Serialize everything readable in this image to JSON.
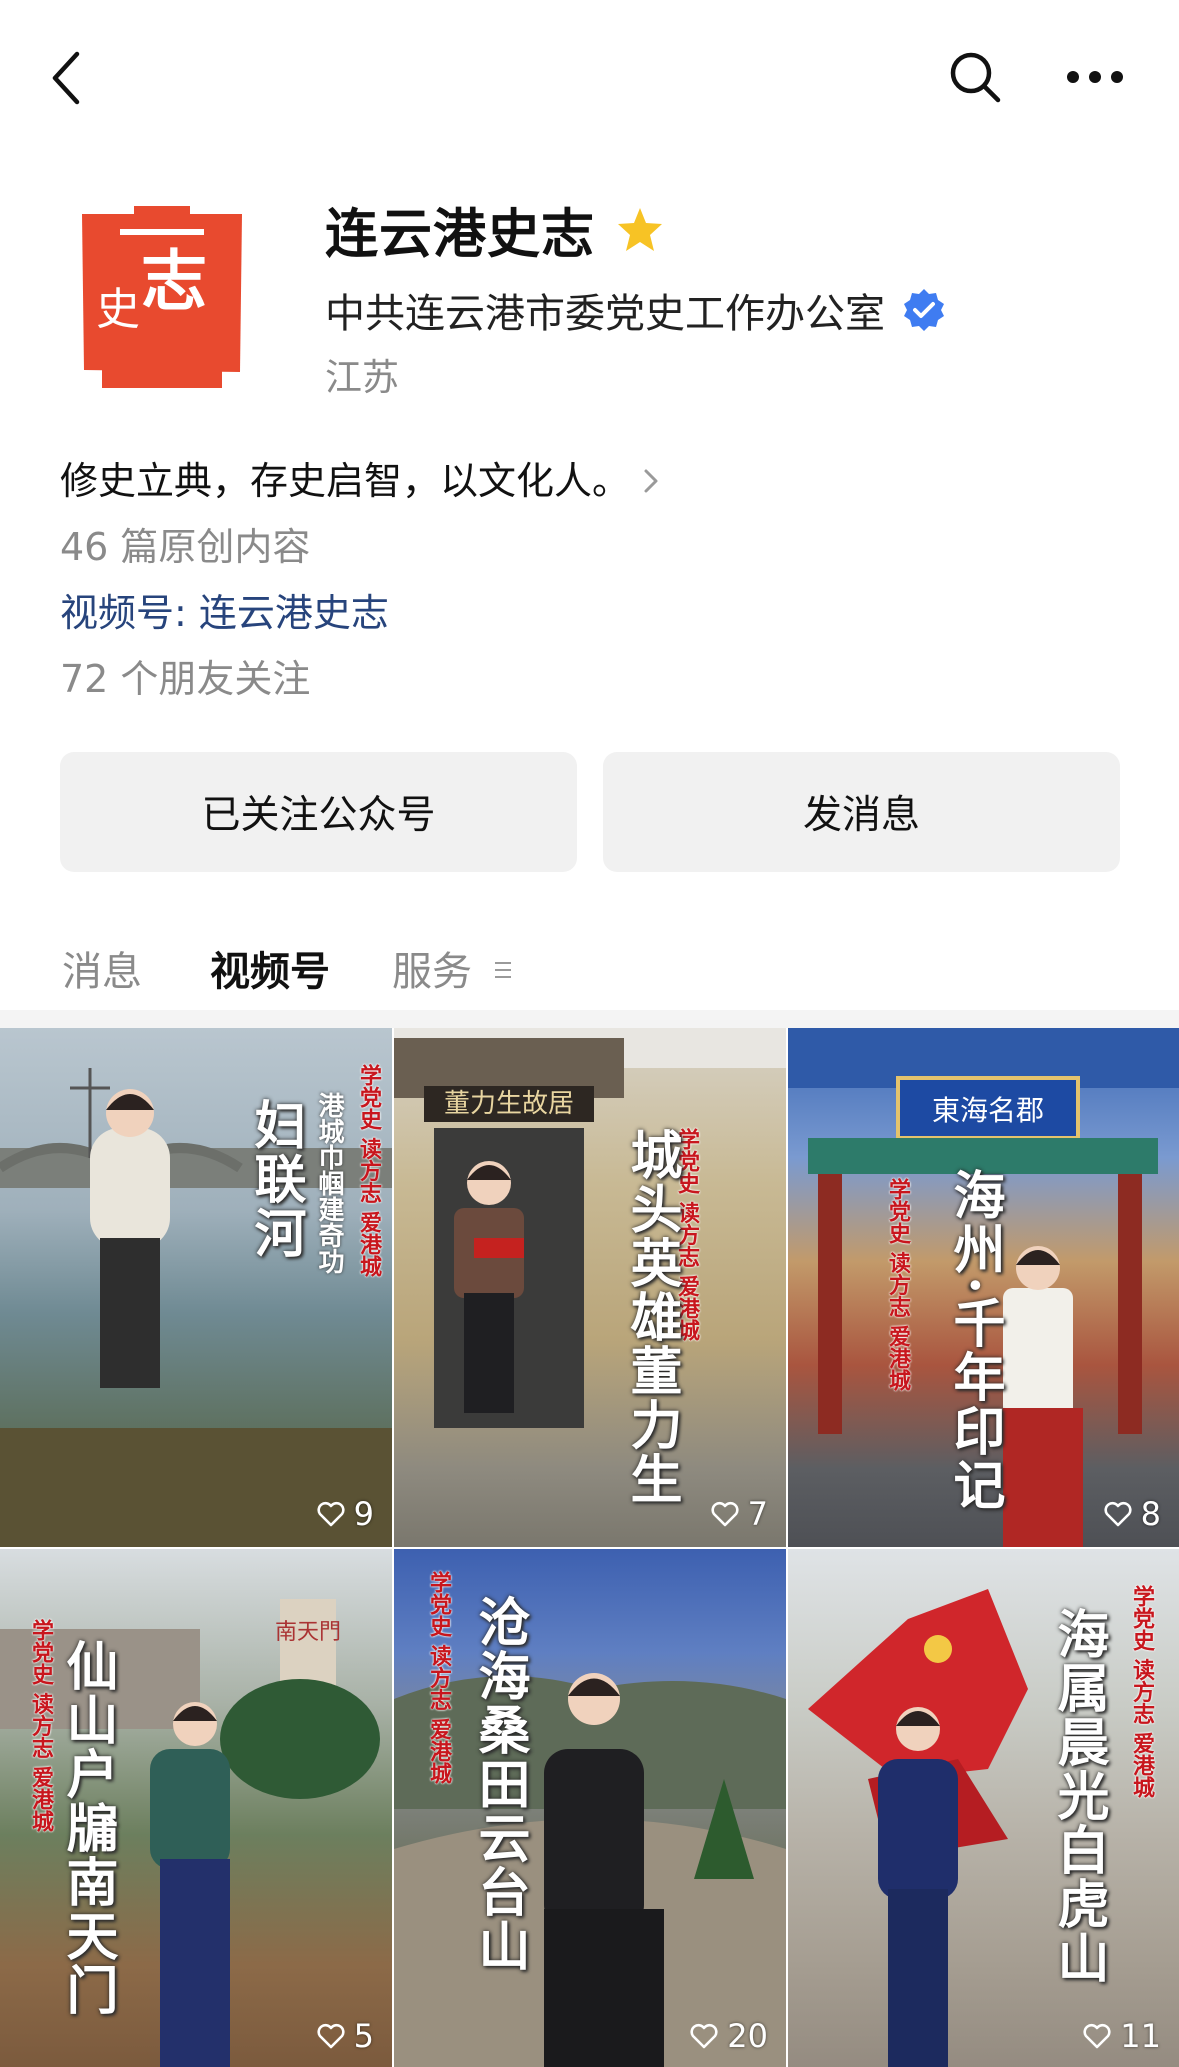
{
  "header": {
    "back_icon": "chevron-left-icon",
    "search_icon": "search-icon",
    "more_icon": "more-horizontal-icon"
  },
  "profile": {
    "name": "连云港史志",
    "organization": "中共连云港市委党史工作办公室",
    "region": "江苏",
    "logo_color": "#e84a2f",
    "star_color": "#f7c325",
    "verified_color": "#3f7cf1"
  },
  "info": {
    "slogan": "修史立典，存史启智，以文化人。",
    "articles": "46 篇原创内容",
    "channel": "视频号: 连云港史志",
    "friends": "72 个朋友关注"
  },
  "buttons": {
    "followed": "已关注公众号",
    "message": "发消息"
  },
  "tabs": [
    {
      "label": "消息"
    },
    {
      "label": "视频号"
    },
    {
      "label": "服务"
    }
  ],
  "videos": [
    {
      "title": "妇联河",
      "subtitle": "港城巾帼建奇功",
      "tag": "学党史 读方志 爱港城",
      "likes": "9"
    },
    {
      "title": "城头英雄董力生",
      "subtitle": "",
      "tag": "学党史 读方志 爱港城",
      "likes": "7",
      "sign": "董力生故居"
    },
    {
      "title": "海州·千年印记",
      "subtitle": "",
      "tag": "学党史 读方志 爱港城",
      "likes": "8",
      "sign": "東海名郡"
    },
    {
      "title": "仙山户牖南天门",
      "subtitle": "",
      "tag": "学党史 读方志 爱港城",
      "likes": "5",
      "sign": "南天門"
    },
    {
      "title": "沧海桑田云台山",
      "subtitle": "",
      "tag": "学党史 读方志 爱港城",
      "likes": "20"
    },
    {
      "title": "海属晨光白虎山",
      "subtitle": "",
      "tag": "学党史 读方志 爱港城",
      "likes": "11"
    }
  ]
}
